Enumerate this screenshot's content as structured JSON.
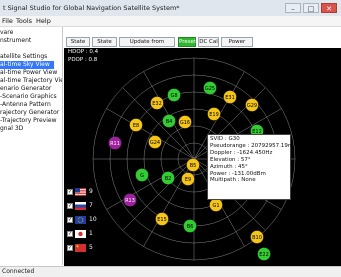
{
  "window": {
    "title": "t Signal Studio for Global Navigation Satellite System*"
  },
  "menu": [
    "File",
    "Tools",
    "Help"
  ],
  "sidebar": {
    "items": [
      {
        "label": "vare"
      },
      {
        "label": "nstrument"
      },
      {
        "label": ""
      },
      {
        "label": "atellite Settings"
      },
      {
        "label": "al-time Sky View",
        "selected": true
      },
      {
        "label": "al-time Power View"
      },
      {
        "label": "al-time Trajectory View"
      },
      {
        "label": "enario Generator"
      },
      {
        "label": "-Scenario Graphics"
      },
      {
        "label": "-Antenna Pattern"
      },
      {
        "label": "rajectory Generator"
      },
      {
        "label": "-Trajectory Preview"
      },
      {
        "label": "gnal 3D"
      }
    ]
  },
  "toolbar": {
    "state_on": "State On",
    "state_off": "State Off",
    "update": "Update from Instrument",
    "preset": "Preset",
    "dc_cal": "DC Cal",
    "power_search": "Power Search"
  },
  "dop": {
    "hdop": "HDOP : 0.4",
    "pdop": "PDOP : 0.8"
  },
  "skyview": {
    "satellites": [
      {
        "id": "E32",
        "color": "#f5c518"
      },
      {
        "id": "G8",
        "color": "#33cc33"
      },
      {
        "id": "G25",
        "color": "#33cc33"
      },
      {
        "id": "E31",
        "color": "#f5c518"
      },
      {
        "id": "G29",
        "color": "#f5c518"
      },
      {
        "id": "E8",
        "color": "#f5c518"
      },
      {
        "id": "B4",
        "color": "#33cc33"
      },
      {
        "id": "G16",
        "color": "#f5c518"
      },
      {
        "id": "E19",
        "color": "#f5c518"
      },
      {
        "id": "E12",
        "color": "#33cc33"
      },
      {
        "id": "R11",
        "color": "#a020a0"
      },
      {
        "id": "G24",
        "color": "#f5c518"
      },
      {
        "id": "G30",
        "color": "#f5c518"
      },
      {
        "id": "E1",
        "color": "#f5c518"
      },
      {
        "id": "B5",
        "color": "#f5c518"
      },
      {
        "id": "E3",
        "color": "#33cc33"
      },
      {
        "id": "G",
        "color": "#33cc33"
      },
      {
        "id": "B2",
        "color": "#33cc33"
      },
      {
        "id": "E9",
        "color": "#f5c518"
      },
      {
        "id": "E2",
        "color": "#f5c518"
      },
      {
        "id": "G1",
        "color": "#f5c518"
      },
      {
        "id": "R13",
        "color": "#a020a0"
      },
      {
        "id": "E15",
        "color": "#f5c518"
      },
      {
        "id": "B6",
        "color": "#33cc33"
      },
      {
        "id": "B10",
        "color": "#f5c518"
      },
      {
        "id": "E22",
        "color": "#33cc33"
      }
    ]
  },
  "legend": [
    {
      "count": "9",
      "flag": "us"
    },
    {
      "count": "7",
      "flag": "ru"
    },
    {
      "count": "10",
      "flag": "eu"
    },
    {
      "count": "1",
      "flag": "jp"
    },
    {
      "count": "5",
      "flag": "cn"
    }
  ],
  "tooltip": {
    "svid": "SVID : G30",
    "pseudorange": "Pseudorange : 20792957.19m",
    "doppler": "Doppler : -1624.450Hz",
    "elevation": "Elevation : 57°",
    "azimuth": "Azimuth : 45°",
    "power": "Power : -131.00dBm",
    "multipath": "Multipath : None"
  },
  "status": {
    "text": "Connected"
  }
}
